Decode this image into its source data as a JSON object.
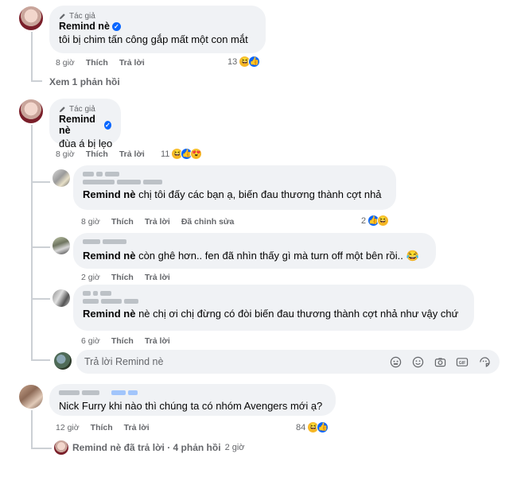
{
  "labels": {
    "author_badge": "Tác giả",
    "like": "Thích",
    "reply": "Trả lời",
    "edited": "Đã chỉnh sửa"
  },
  "comment1": {
    "name": "Remind nè",
    "text": "tôi bị chim tấn công gắp mất một con mắt",
    "time": "8 giờ",
    "reaction_count": "13",
    "view_replies": "Xem 1 phản hồi"
  },
  "comment2": {
    "name": "Remind nè",
    "text": "đùa á bị lẹo",
    "time": "8 giờ",
    "reaction_count": "11",
    "replies": [
      {
        "mention": "Remind nè",
        "text": " chị tôi đấy các bạn ạ, biến đau thương thành cợt nhả",
        "time": "8 giờ",
        "reaction_count": "2"
      },
      {
        "mention": "Remind nè",
        "text": " còn ghê hơn.. fen đã nhìn thấy gì mà turn off một bên rồi.. 😂",
        "time": "2 giờ"
      },
      {
        "mention": "Remind nè",
        "text": " nè chị ơi chị đừng có đòi biến đau thương thành cợt nhả như vậy chứ",
        "time": "6 giờ"
      }
    ],
    "reply_placeholder": "Trả lời Remind nè"
  },
  "comment3": {
    "text": "Nick Furry khi nào thì chúng ta có nhóm Avengers mới ạ?",
    "time": "12 giờ",
    "reaction_count": "84",
    "replied_summary": "Remind nè đã trả lời · 4 phản hồi",
    "replied_time": "2 giờ"
  },
  "icons": {
    "author_badge": "pencil-icon",
    "verified": "verified-badge-icon",
    "reactions": [
      "haha-reaction-icon",
      "like-reaction-icon",
      "love-reaction-icon"
    ],
    "composer_tools": [
      "emoji-icon",
      "avatar-sticker-icon",
      "camera-icon",
      "gif-icon",
      "sticker-icon"
    ]
  },
  "colors": {
    "accent": "#0866ff",
    "bubble": "#f0f2f5",
    "secondary_text": "#65676b"
  }
}
